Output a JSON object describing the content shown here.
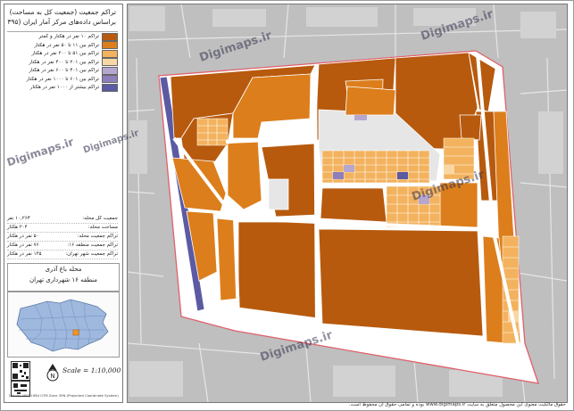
{
  "panel": {
    "title_lines": [
      "تراکم جمعیت (جمعیت کل به مساحت)",
      "براساس داده‌های مرکز آمار ایران (۱۳۹۵)"
    ],
    "legend": [
      {
        "label": "تراکم ۱۰ نفر در هکتار و کمتر",
        "color": "#b75a0e"
      },
      {
        "label": "تراکم بین ۱۱ تا ۵۰ نفر در هکتار",
        "color": "#dc7e1c"
      },
      {
        "label": "تراکم بین ۵۱ تا ۲۰۰ نفر در هکتار",
        "color": "#f3b25e"
      },
      {
        "label": "تراکم بین ۲۰۱ تا ۴۰۰ نفر در هکتار",
        "color": "#fad7a5"
      },
      {
        "label": "تراکم بین ۴۰۱ تا ۶۰۰ نفر در هکتار",
        "color": "#b7a7cf"
      },
      {
        "label": "تراکم بین ۶۰۱ تا ۱۰۰۰ نفر در هکتار",
        "color": "#8e7fbc"
      },
      {
        "label": "تراکم بیشتر از ۱۰۰۰ نفر در هکتار",
        "color": "#5b5aa3"
      }
    ],
    "stats": [
      {
        "label": "جمعیت کل محله:",
        "value": "۱۰,۲۶۳ نفر"
      },
      {
        "label": "مساحت محله:",
        "value": "۲۰۴ هکتار"
      },
      {
        "label": "تراکم جمعیت محله:",
        "value": "۵۰ نفر در هکتار"
      },
      {
        "label": "تراکم جمعیت منطقه ۱۶:",
        "value": "۷۶ نفر در هکتار"
      },
      {
        "label": "تراکم جمعیت شهر تهران:",
        "value": "۱۴۵ نفر در هکتار"
      }
    ],
    "area_name": "محله باغ آذری",
    "area_region": "منطقه ۱۶ شهرداری تهران",
    "scale": "Scale = 1:10,000",
    "coord_note": "Datum: WGS1984 UTM Zone 39N (Projected Coordinate System)"
  },
  "footer": {
    "text": "حقوق مالکیت معنوی این محصول متعلق به سایت www.digimaps.ir بوده و تمامی حقوق آن محفوظ است."
  },
  "watermarks": [
    "Digimaps.ir",
    "Digimaps.ir",
    "Digimaps.ir",
    "Digimaps.ir",
    "Digimaps.ir",
    "Digimaps.ir"
  ]
}
